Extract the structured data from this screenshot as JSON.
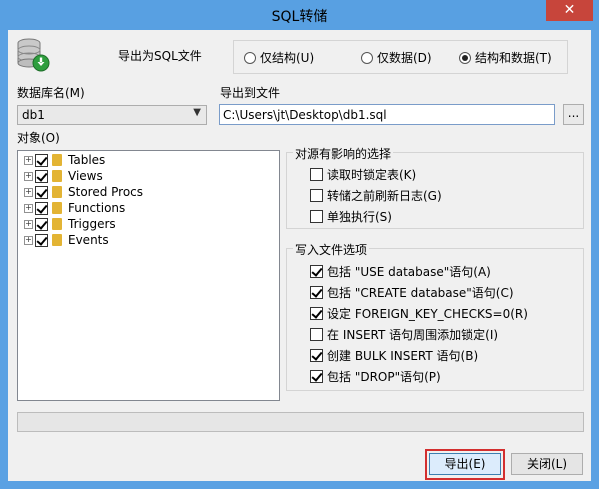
{
  "window": {
    "title": "SQL转储",
    "close_label": "✕"
  },
  "export_as": {
    "label": "导出为SQL文件",
    "options": [
      {
        "label": "仅结构(U)",
        "selected": false
      },
      {
        "label": "仅数据(D)",
        "selected": false
      },
      {
        "label": "结构和数据(T)",
        "selected": true
      }
    ]
  },
  "database": {
    "label": "数据库名(M)",
    "value": "db1"
  },
  "export_to": {
    "label": "导出到文件",
    "value": "C:\\Users\\jt\\Desktop\\db1.sql",
    "browse_label": "..."
  },
  "objects": {
    "label": "对象(O)",
    "items": [
      {
        "label": "Tables",
        "checked": true
      },
      {
        "label": "Views",
        "checked": true
      },
      {
        "label": "Stored Procs",
        "checked": true
      },
      {
        "label": "Functions",
        "checked": true
      },
      {
        "label": "Triggers",
        "checked": true
      },
      {
        "label": "Events",
        "checked": true
      }
    ]
  },
  "source_options": {
    "title": "对源有影响的选择",
    "items": [
      {
        "label": "读取时锁定表(K)",
        "checked": false
      },
      {
        "label": "转储之前刷新日志(G)",
        "checked": false
      },
      {
        "label": "单独执行(S)",
        "checked": false
      }
    ]
  },
  "file_options": {
    "title": "写入文件选项",
    "items": [
      {
        "label": "包括 \"USE database\"语句(A)",
        "checked": true
      },
      {
        "label": "包括 \"CREATE database\"语句(C)",
        "checked": true
      },
      {
        "label": "设定 FOREIGN_KEY_CHECKS=0(R)",
        "checked": true
      },
      {
        "label": "在 INSERT 语句周围添加锁定(I)",
        "checked": false
      },
      {
        "label": "创建 BULK INSERT 语句(B)",
        "checked": true
      },
      {
        "label": "包括 \"DROP\"语句(P)",
        "checked": true
      }
    ]
  },
  "progress": {
    "value": 0
  },
  "buttons": {
    "export": "导出(E)",
    "close": "关闭(L)"
  }
}
